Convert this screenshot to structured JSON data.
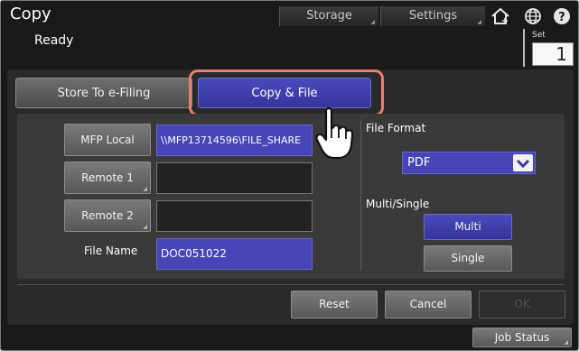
{
  "header": {
    "title": "Copy",
    "storage_label": "Storage",
    "settings_label": "Settings",
    "icons": [
      "home-icon",
      "globe-icon",
      "help-icon"
    ]
  },
  "status": {
    "text": "Ready"
  },
  "set": {
    "label": "Set",
    "value": "1"
  },
  "tabs": [
    {
      "label": "Store To e-Filing",
      "selected": false
    },
    {
      "label": "Copy & File",
      "selected": true
    }
  ],
  "destinations": {
    "mfp_local_label": "MFP Local",
    "mfp_local_path": "\\\\MFP13714596\\FILE_SHARE",
    "remote1_label": "Remote 1",
    "remote1_value": "",
    "remote2_label": "Remote 2",
    "remote2_value": ""
  },
  "file_name": {
    "label": "File Name",
    "value": "DOC051022"
  },
  "file_format": {
    "label": "File Format",
    "selected": "PDF"
  },
  "multi_single": {
    "label": "Multi/Single",
    "multi_label": "Multi",
    "single_label": "Single",
    "selected": "Multi"
  },
  "actions": {
    "reset_label": "Reset",
    "cancel_label": "Cancel",
    "ok_label": "OK"
  },
  "footer": {
    "job_status_label": "Job Status"
  },
  "colors": {
    "accent": "#3f3fb0",
    "highlight": "#e8806f",
    "background": "#1a1a1a"
  }
}
